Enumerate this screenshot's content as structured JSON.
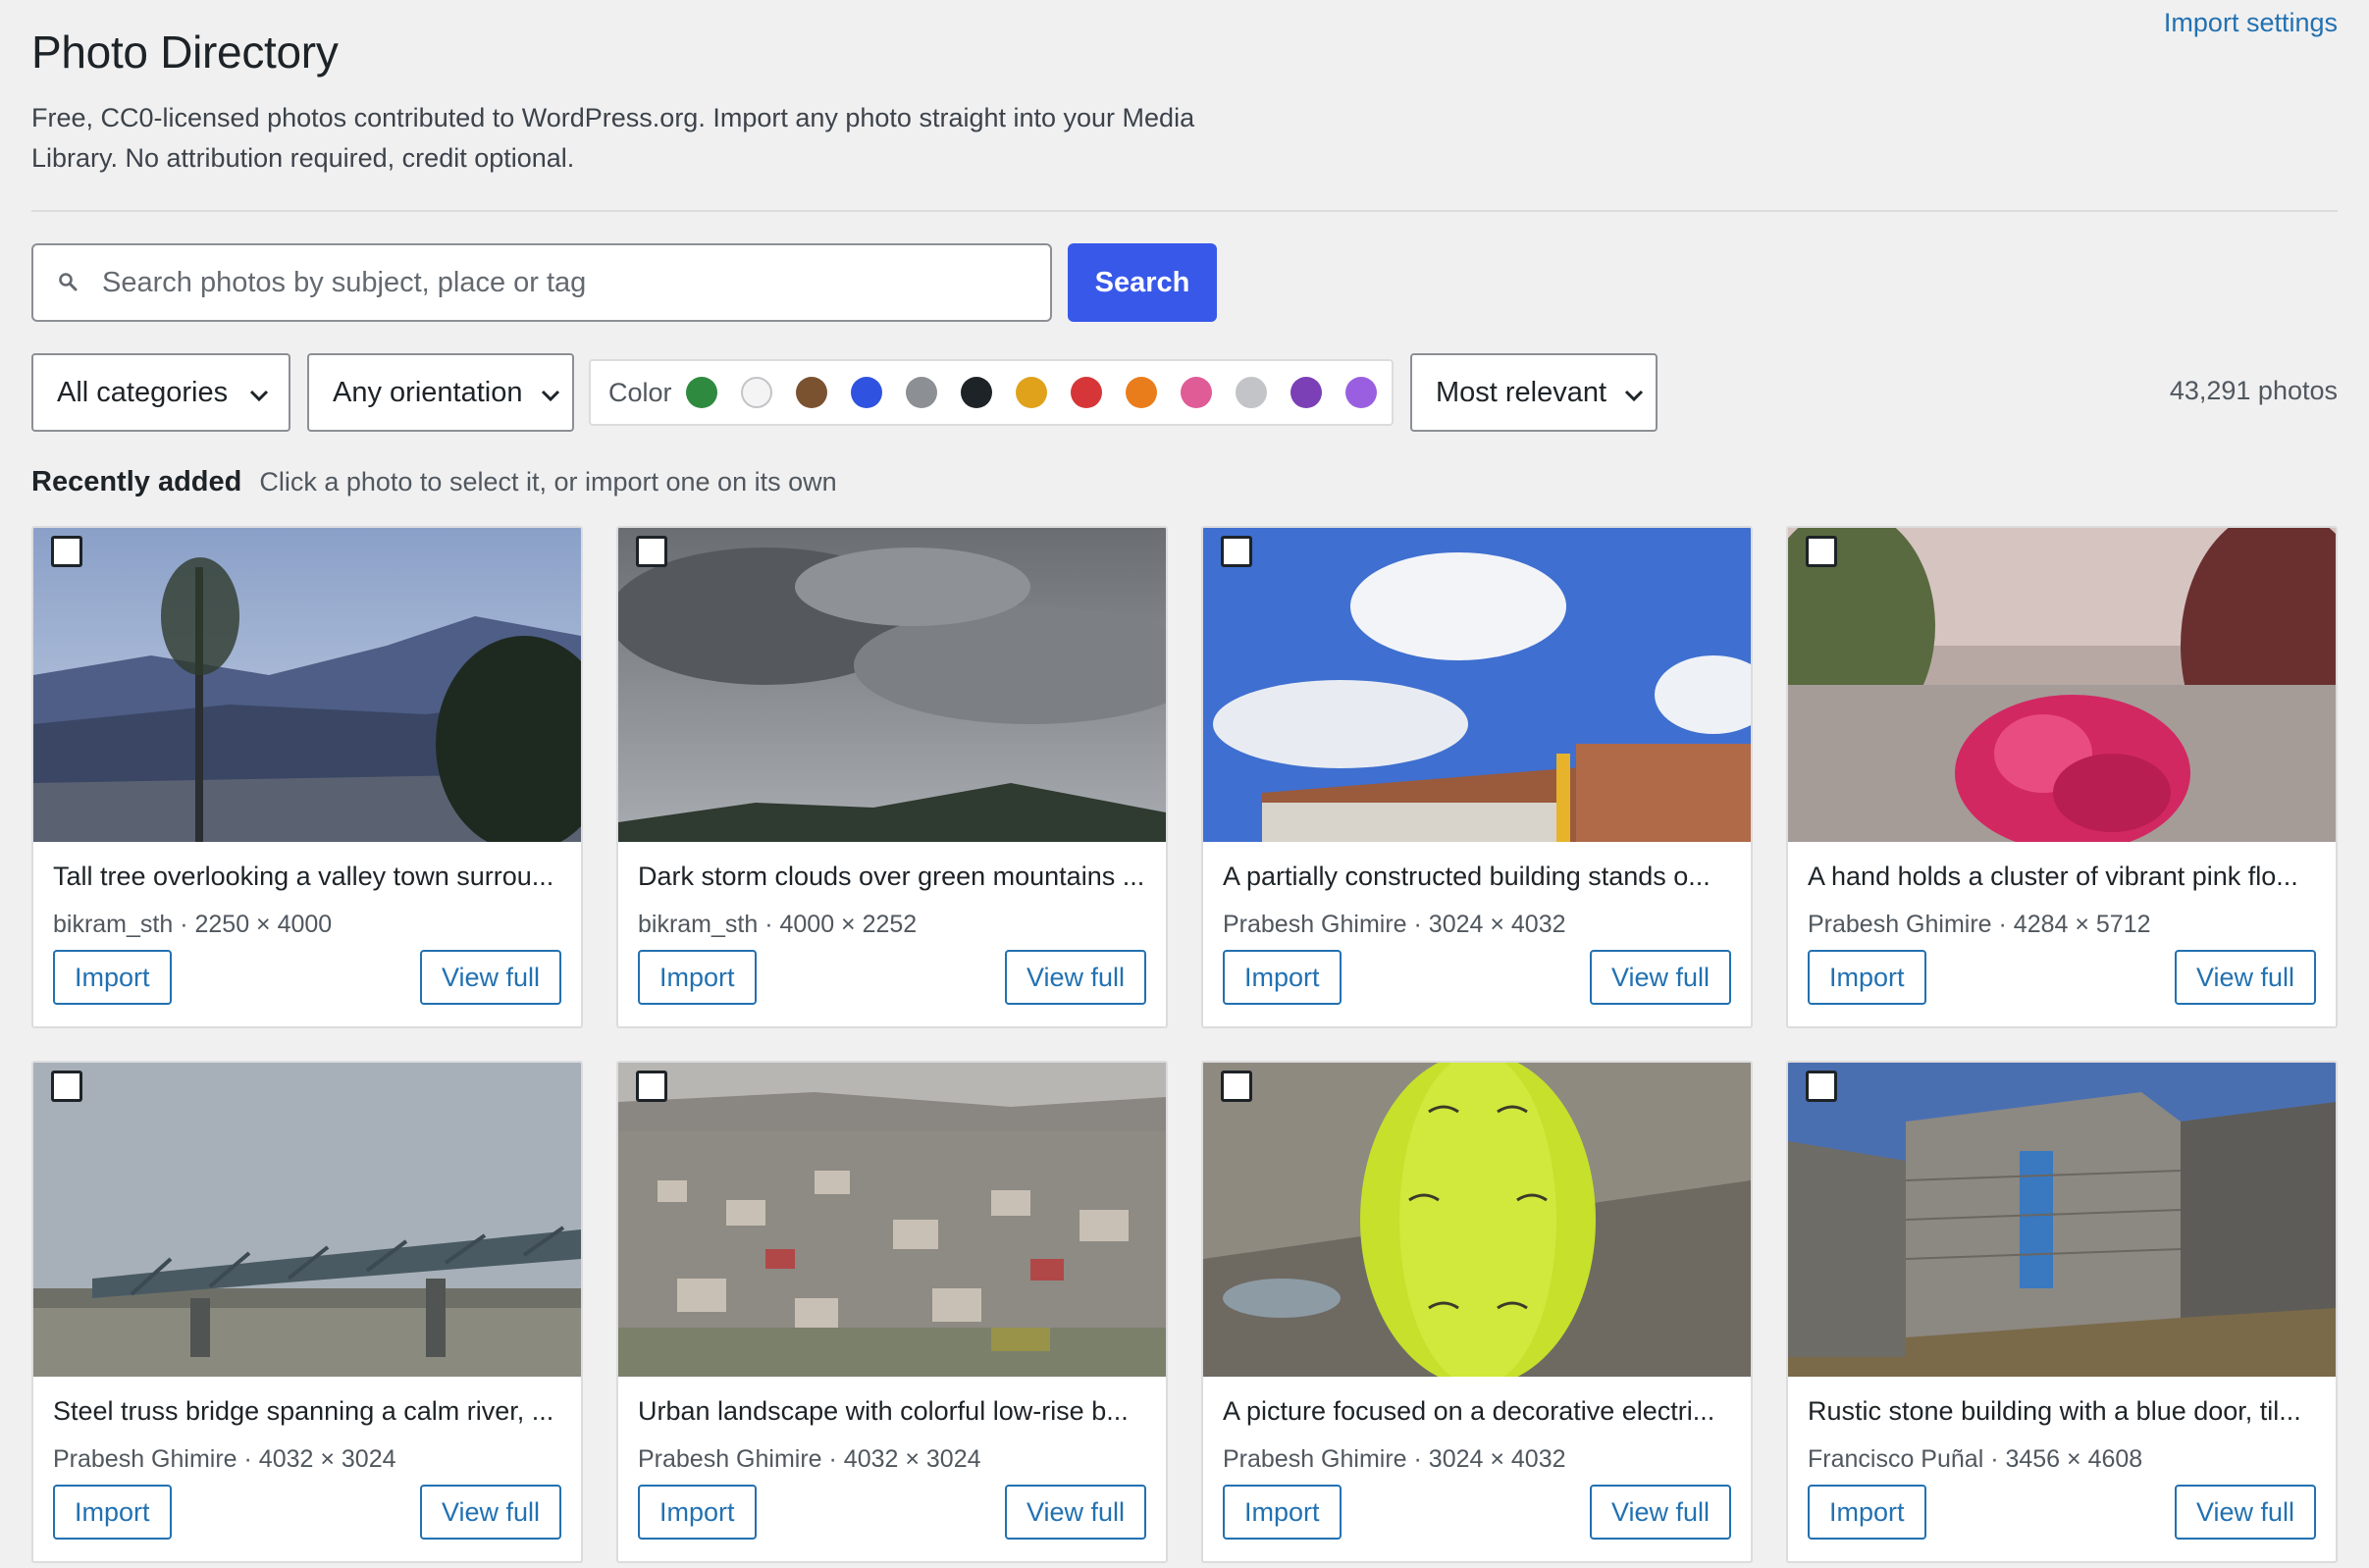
{
  "header": {
    "import_settings": "Import settings",
    "title": "Photo Directory",
    "description": "Free, CC0-licensed photos contributed to WordPress.org. Import any photo straight into your Media Library. No attribution required, credit optional."
  },
  "search": {
    "placeholder": "Search photos by subject, place or tag",
    "value": "",
    "button": "Search"
  },
  "filters": {
    "category": "All categories",
    "orientation": "Any orientation",
    "color_label": "Color",
    "colors": [
      "#2e8a3f",
      "#f4f4f4",
      "#7a5230",
      "#2f52e0",
      "#8c8f94",
      "#1d2327",
      "#e0a21a",
      "#d63638",
      "#ea7d1b",
      "#e05c97",
      "#c3c4c7",
      "#7b3fb6",
      "#9a5fe0"
    ],
    "sort": "Most relevant"
  },
  "photo_count": "43,291 photos",
  "section": {
    "title": "Recently added",
    "hint": "Click a photo to select it, or import one on its own"
  },
  "photos": [
    {
      "title": "Tall tree overlooking a valley town surrou...",
      "meta": "bikram_sth · 2250 × 4000",
      "import": "Import",
      "view": "View full"
    },
    {
      "title": "Dark storm clouds over green mountains ...",
      "meta": "bikram_sth · 4000 × 2252",
      "import": "Import",
      "view": "View full"
    },
    {
      "title": "A partially constructed building stands o...",
      "meta": "Prabesh Ghimire · 3024 × 4032",
      "import": "Import",
      "view": "View full"
    },
    {
      "title": "A hand holds a cluster of vibrant pink flo...",
      "meta": "Prabesh Ghimire · 4284 × 5712",
      "import": "Import",
      "view": "View full"
    },
    {
      "title": "Steel truss bridge spanning a calm river, ...",
      "meta": "Prabesh Ghimire · 4032 × 3024",
      "import": "Import",
      "view": "View full"
    },
    {
      "title": "Urban landscape with colorful low-rise b...",
      "meta": "Prabesh Ghimire · 4032 × 3024",
      "import": "Import",
      "view": "View full"
    },
    {
      "title": "A picture focused on a decorative electri...",
      "meta": "Prabesh Ghimire · 3024 × 4032",
      "import": "Import",
      "view": "View full"
    },
    {
      "title": "Rustic stone building with a blue door, til...",
      "meta": "Francisco Puñal · 3456 × 4608",
      "import": "Import",
      "view": "View full"
    }
  ]
}
